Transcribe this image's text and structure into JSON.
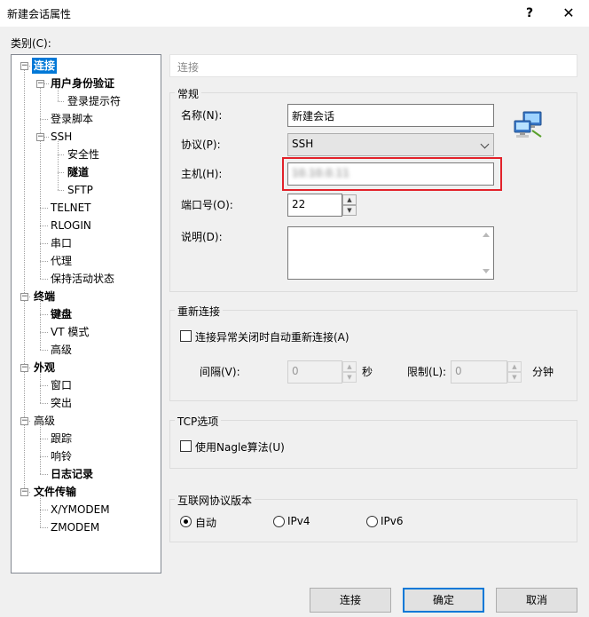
{
  "window": {
    "title": "新建会话属性",
    "help": "?",
    "close": "✕"
  },
  "category_label": "类别(C):",
  "tree": [
    {
      "label": "连接",
      "state": "selected"
    },
    {
      "label": "用户身份验证",
      "state": "bold"
    },
    {
      "label": "登录提示符",
      "state": "normal"
    },
    {
      "label": "登录脚本",
      "state": "normal"
    },
    {
      "label": "SSH",
      "state": "normal"
    },
    {
      "label": "安全性",
      "state": "normal"
    },
    {
      "label": "隧道",
      "state": "bold"
    },
    {
      "label": "SFTP",
      "state": "normal"
    },
    {
      "label": "TELNET",
      "state": "normal"
    },
    {
      "label": "RLOGIN",
      "state": "normal"
    },
    {
      "label": "串口",
      "state": "normal"
    },
    {
      "label": "代理",
      "state": "normal"
    },
    {
      "label": "保持活动状态",
      "state": "normal"
    },
    {
      "label": "终端",
      "state": "bold"
    },
    {
      "label": "键盘",
      "state": "bold"
    },
    {
      "label": "VT 模式",
      "state": "normal"
    },
    {
      "label": "高级",
      "state": "normal"
    },
    {
      "label": "外观",
      "state": "bold"
    },
    {
      "label": "窗口",
      "state": "normal"
    },
    {
      "label": "突出",
      "state": "normal"
    },
    {
      "label": "高级",
      "state": "normal"
    },
    {
      "label": "跟踪",
      "state": "normal"
    },
    {
      "label": "响铃",
      "state": "normal"
    },
    {
      "label": "日志记录",
      "state": "bold"
    },
    {
      "label": "文件传输",
      "state": "bold"
    },
    {
      "label": "X/YMODEM",
      "state": "normal"
    },
    {
      "label": "ZMODEM",
      "state": "normal"
    }
  ],
  "breadcrumb": "连接",
  "general": {
    "title": "常规",
    "name_label": "名称(N):",
    "name_value": "新建会话",
    "protocol_label": "协议(P):",
    "protocol_value": "SSH",
    "host_label": "主机(H):",
    "host_value": "10.10.0.11",
    "port_label": "端口号(O):",
    "port_value": "22",
    "desc_label": "说明(D):",
    "desc_value": ""
  },
  "reconnect": {
    "title": "重新连接",
    "checkbox_label": "连接异常关闭时自动重新连接(A)",
    "interval_label": "间隔(V):",
    "interval_value": "0",
    "interval_unit": "秒",
    "limit_label": "限制(L):",
    "limit_value": "0",
    "limit_unit": "分钟"
  },
  "tcp": {
    "title": "TCP选项",
    "nagle_label": "使用Nagle算法(U)"
  },
  "ipver": {
    "title": "互联网协议版本",
    "options": [
      {
        "label": "自动",
        "selected": true
      },
      {
        "label": "IPv4",
        "selected": false
      },
      {
        "label": "IPv6",
        "selected": false
      }
    ]
  },
  "buttons": {
    "connect": "连接",
    "ok": "确定",
    "cancel": "取消"
  },
  "colors": {
    "selection": "#0078d7",
    "highlight_border": "#e2222a"
  }
}
